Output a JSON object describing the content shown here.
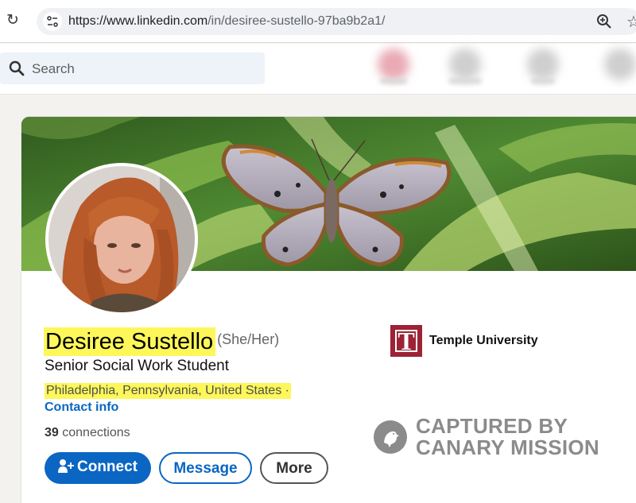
{
  "browser": {
    "url_domain": "https://www.linkedin.com",
    "url_path": "/in/desiree-sustello-97ba9b2a1/",
    "icons": [
      "reload-icon",
      "site-info-icon",
      "zoom-icon",
      "star-icon"
    ]
  },
  "header": {
    "search_placeholder": "Search"
  },
  "profile": {
    "name": "Desiree Sustello",
    "pronouns": "(She/Her)",
    "headline": "Senior Social Work Student",
    "location": "Philadelphia, Pennsylvania, United States ·",
    "contact_info": "Contact info",
    "connections_count": "39",
    "connections_label": "connections",
    "buttons": {
      "connect": "Connect",
      "message": "Message",
      "more": "More"
    },
    "education": {
      "name": "Temple University",
      "logo_letter": "T",
      "logo_color": "#9d2235"
    }
  },
  "watermark": {
    "line1": "CAPTURED BY",
    "line2": "CANARY MISSION"
  },
  "colors": {
    "linkedin_blue": "#0a66c2",
    "highlight": "#fdf75a",
    "watermark": "#8b8b8b"
  }
}
